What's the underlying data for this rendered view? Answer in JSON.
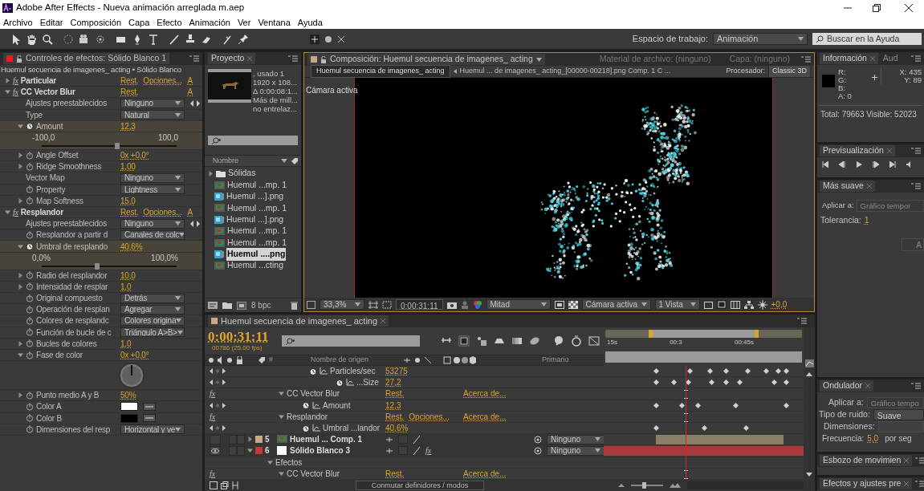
{
  "window": {
    "title": "Adobe After Effects - Nueva animación arreglada m.aep"
  },
  "menu": [
    "Archivo",
    "Editar",
    "Composición",
    "Capa",
    "Efecto",
    "Animación",
    "Ver",
    "Ventana",
    "Ayuda"
  ],
  "toolbar": {
    "workspace_label": "Espacio de trabajo:",
    "workspace": "Animación",
    "help_search": {
      "placeholder": "Buscar en la Ayuda"
    }
  },
  "effect_controls": {
    "tab": "Controles de efectos: Sólido Blanco 1",
    "subtitle": "Huemul secuencia de imagenes_ acting • Sólido Blanco",
    "rows": [
      {
        "kind": "effect",
        "badge": "fx",
        "label": "Particular",
        "expanded": false,
        "links": [
          {
            "kind": "reset",
            "label": "Rest."
          },
          {
            "kind": "options",
            "label": "Opciones..."
          },
          {
            "kind": "about",
            "label": "A"
          }
        ]
      },
      {
        "kind": "effect",
        "badge": "fx",
        "label": "CC Vector Blur",
        "expanded": true,
        "links": [
          {
            "kind": "reset",
            "label": "Rest."
          },
          {
            "kind": "about",
            "label": "A"
          }
        ]
      },
      {
        "kind": "dropdown",
        "label": "Ajustes preestablecidos",
        "value": "Ninguno",
        "stopwatch": false,
        "stepper": true
      },
      {
        "kind": "dropdown",
        "label": "Type",
        "value": "Natural",
        "stopwatch": false,
        "stepper": false
      },
      {
        "kind": "value",
        "label": "Amount",
        "value": "12,3",
        "expanded": true,
        "selected": true,
        "slider": {
          "min": "-100,0",
          "max": "100,0",
          "level": 0.56
        }
      },
      {
        "kind": "value",
        "label": "Angle Offset",
        "value": "0x +0,0°",
        "expanded": false,
        "selected": false
      },
      {
        "kind": "value",
        "label": "Ridge Smoothness",
        "value": "1,00",
        "expanded": false,
        "selected": false
      },
      {
        "kind": "dropdown",
        "label": "Vector Map",
        "value": "Ninguno",
        "stopwatch": false,
        "stepper": false
      },
      {
        "kind": "dropdown",
        "label": "Property",
        "value": "Lightness",
        "stopwatch": true,
        "stepper": false
      },
      {
        "kind": "value",
        "label": "Map Softness",
        "value": "15,0",
        "expanded": false,
        "selected": false
      },
      {
        "kind": "effect",
        "badge": "fx",
        "label": "Resplandor",
        "expanded": true,
        "links": [
          {
            "kind": "reset",
            "label": "Rest."
          },
          {
            "kind": "options",
            "label": "Opciones..."
          },
          {
            "kind": "about",
            "label": "A"
          }
        ]
      },
      {
        "kind": "dropdown",
        "label": "Ajustes preestablecidos",
        "value": "Ninguno",
        "stopwatch": false,
        "stepper": true
      },
      {
        "kind": "dropdown",
        "label": "Resplandor a partir d",
        "value": "Canales de colc",
        "stopwatch": true,
        "stepper": false
      },
      {
        "kind": "value",
        "label": "Umbral de resplando",
        "value": "40,6%",
        "expanded": true,
        "selected": true,
        "slider": {
          "min": "0,0%",
          "max": "100,0%",
          "level": 0.41
        }
      },
      {
        "kind": "value",
        "label": "Radio del resplandor",
        "value": "10,0",
        "expanded": false,
        "selected": false
      },
      {
        "kind": "value",
        "label": "Intensidad de resplar",
        "value": "1,0",
        "expanded": false,
        "selected": false
      },
      {
        "kind": "dropdown",
        "label": "Original compuesto",
        "value": "Detrás",
        "stopwatch": true,
        "stepper": false
      },
      {
        "kind": "dropdown",
        "label": "Operación de resplan",
        "value": "Agregar",
        "stopwatch": true,
        "stepper": false
      },
      {
        "kind": "dropdown",
        "label": "Colores de resplandc",
        "value": "Colores origina",
        "stopwatch": true,
        "stepper": false
      },
      {
        "kind": "dropdown",
        "label": "Función de bucle de c",
        "value": "Triángulo A>B>",
        "stopwatch": true,
        "stepper": false
      },
      {
        "kind": "value",
        "label": "Bucles de colores",
        "value": "1,0",
        "expanded": false,
        "selected": false
      },
      {
        "kind": "value",
        "label": "Fase de color",
        "value": "0x +0,0°",
        "expanded": true,
        "selected": false,
        "dial": true
      },
      {
        "kind": "value",
        "label": "Punto medio A y B",
        "value": "50%",
        "expanded": false,
        "selected": false
      },
      {
        "kind": "color",
        "label": "Color A",
        "color": "#ffffff"
      },
      {
        "kind": "color",
        "label": "Color B",
        "color": "#000000"
      },
      {
        "kind": "dropdown",
        "label": "Dimensiones del resp",
        "value": "Horizontal y ve",
        "stopwatch": true,
        "stepper": false
      }
    ]
  },
  "project": {
    "tab": "Proyecto",
    "info": [
      ", usado 1",
      "1920 x 108...",
      "Δ 0:00:08:1...",
      "Más de mill...",
      "no entrelaz..."
    ],
    "column": "Nombre",
    "items": [
      {
        "name": "Sólidas",
        "kind": "folder",
        "selected": false
      },
      {
        "name": "Huemul ...mp. 1",
        "kind": "comp",
        "selected": false
      },
      {
        "name": "Huemul ...].png",
        "kind": "sequence",
        "selected": false
      },
      {
        "name": "Huemul ...mp. 1",
        "kind": "comp",
        "selected": false
      },
      {
        "name": "Huemul ...].png",
        "kind": "sequence",
        "selected": false
      },
      {
        "name": "Huemul ...mp. 1",
        "kind": "comp",
        "selected": false
      },
      {
        "name": "Huemul ...mp. 1",
        "kind": "comp",
        "selected": false
      },
      {
        "name": "Huemul ....png",
        "kind": "sequence",
        "selected": true
      },
      {
        "name": "Huemul ...cting",
        "kind": "comp",
        "selected": false
      }
    ],
    "depth": "8 bpc"
  },
  "composition": {
    "tabs": [
      {
        "label": "Composición: Huemul secuencia de imagenes_ acting",
        "selected": true
      },
      {
        "label": "Material de archivo: (ninguno)",
        "selected": false
      },
      {
        "label": "Capa: (ninguno)",
        "selected": false
      }
    ],
    "breadcrumbs": [
      {
        "label": "Huemul secuencia de imagenes_ acting",
        "selected": true
      },
      {
        "label": "Huemul ... de imagenes_ acting_[00000-00218].png Comp. 1 C ...",
        "selected": false
      }
    ],
    "renderer_label": "Procesador:",
    "renderer": "Classic 3D",
    "camera_label": "Cámara activa",
    "footer": {
      "zoom": "33,3%",
      "timecode": "0:00:31:11",
      "resolution": "Mitad",
      "camera": "Cámara activa",
      "views": "1 Vista",
      "exposure": "+0,0"
    }
  },
  "info": {
    "tabs": [
      {
        "label": "Información",
        "selected": true
      },
      {
        "label": "Aud",
        "selected": false
      }
    ],
    "channels": [
      "R:",
      "G:",
      "B:",
      "A: 0"
    ],
    "coords": [
      "X: 435",
      "Y: 89"
    ],
    "totals": "Total: 79663  Visible: 52023"
  },
  "preview": {
    "tab": "Previsualización"
  },
  "smoother": {
    "tab": "Más suave",
    "apply_label": "Aplicar a:",
    "apply_value": "Gráfico tempor",
    "tolerance_label": "Tolerancia:",
    "tolerance": "1",
    "button": "A"
  },
  "wiggler": {
    "tab": "Ondulador",
    "apply_label": "Aplicar a:",
    "apply_value": "Gráfico tempo",
    "noise_label": "Tipo de ruido:",
    "noise": "Suave",
    "dimensions_label": "Dimensiones:",
    "frequency_label": "Frecuencia:",
    "frequency": "5,0",
    "frequency_unit": "por seg"
  },
  "motion_sketch": {
    "tab": "Esbozo de movimien"
  },
  "effects_presets": {
    "tab": "Efectos y ajustes pre"
  },
  "timeline": {
    "tab": "Huemul secuencia de imagenes_ acting",
    "timecode": "0:00:31:11",
    "frame_info": "00786 (25.00 fps)",
    "columns": [
      "#",
      "Nombre de origen",
      "Primario"
    ],
    "ruler": [
      "15s",
      "00:3",
      "00:45s"
    ],
    "rows": [
      {
        "kind": "property",
        "name": "Particles/sec",
        "value": "53275",
        "children": [
          {
            "kind": "property",
            "name": "...Size",
            "value": "27,2"
          }
        ]
      },
      {
        "kind": "effect",
        "badge": "fx",
        "name": "CC Vector Blur",
        "expanded": true,
        "links": [
          {
            "kind": "reset",
            "label": "Rest."
          },
          {
            "kind": "about",
            "label": "Acerca de..."
          }
        ],
        "children": [
          {
            "kind": "property",
            "name": "Amount",
            "value": "12,3"
          }
        ]
      },
      {
        "kind": "effect",
        "badge": "fx",
        "name": "Resplandor",
        "expanded": true,
        "links": [
          {
            "kind": "reset",
            "label": "Rest."
          },
          {
            "kind": "options",
            "label": "Opciones..."
          },
          {
            "kind": "about",
            "label": "Acerca de..."
          }
        ],
        "children": [
          {
            "kind": "property",
            "name": "Umbral ...landor",
            "value": "40,6%"
          }
        ]
      },
      {
        "kind": "layer",
        "number": "5",
        "name": "Huemul ... Comp. 1",
        "color": "#c2ab85",
        "visible": false,
        "expanded": false,
        "parent": "Ninguno"
      },
      {
        "kind": "layer",
        "number": "6",
        "name": "Sólido Blanco 3",
        "color": "#c43a3a",
        "visible": true,
        "expanded": true,
        "fx": "fx",
        "parent": "Ninguno",
        "children": [
          {
            "kind": "group",
            "name": "Efectos",
            "expanded": true,
            "children": [
              {
                "kind": "effect",
                "badge": "fx",
                "name": "CC Vector Blur",
                "expanded": true,
                "links": [
                  {
                    "kind": "reset",
                    "label": "Rest."
                  },
                  {
                    "kind": "about",
                    "label": "Acerca de..."
                  }
                ]
              }
            ]
          }
        ]
      }
    ],
    "zoom": {
      "level": 0.4
    },
    "footer": "Conmutar definidores / modos"
  }
}
